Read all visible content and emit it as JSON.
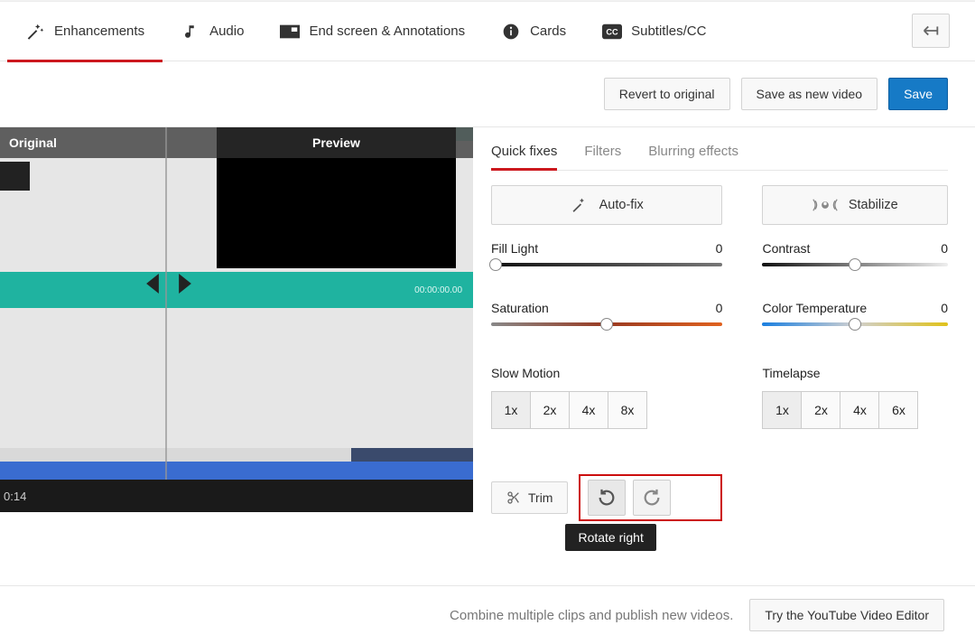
{
  "tabs": {
    "enhancements": "Enhancements",
    "audio": "Audio",
    "endscreen": "End screen & Annotations",
    "cards": "Cards",
    "subtitles": "Subtitles/CC"
  },
  "actions": {
    "revert": "Revert to original",
    "saveas": "Save as new video",
    "save": "Save"
  },
  "preview": {
    "original": "Original",
    "preview": "Preview",
    "timestamp": "0:14",
    "clip_time": "00:00:00.00"
  },
  "subtabs": {
    "quickfixes": "Quick fixes",
    "filters": "Filters",
    "blurring": "Blurring effects"
  },
  "quickfixes": {
    "autofix": "Auto-fix",
    "stabilize": "Stabilize",
    "fill_light_label": "Fill Light",
    "fill_light_value": "0",
    "contrast_label": "Contrast",
    "contrast_value": "0",
    "saturation_label": "Saturation",
    "saturation_value": "0",
    "color_temp_label": "Color Temperature",
    "color_temp_value": "0",
    "slowmotion_label": "Slow Motion",
    "timelapse_label": "Timelapse",
    "slowmo_options": [
      "1x",
      "2x",
      "4x",
      "8x"
    ],
    "timelapse_options": [
      "1x",
      "2x",
      "4x",
      "6x"
    ],
    "trim": "Trim"
  },
  "tooltip": {
    "rotate_right": "Rotate right"
  },
  "footer": {
    "combine": "Combine multiple clips and publish new videos.",
    "try_editor": "Try the YouTube Video Editor"
  }
}
